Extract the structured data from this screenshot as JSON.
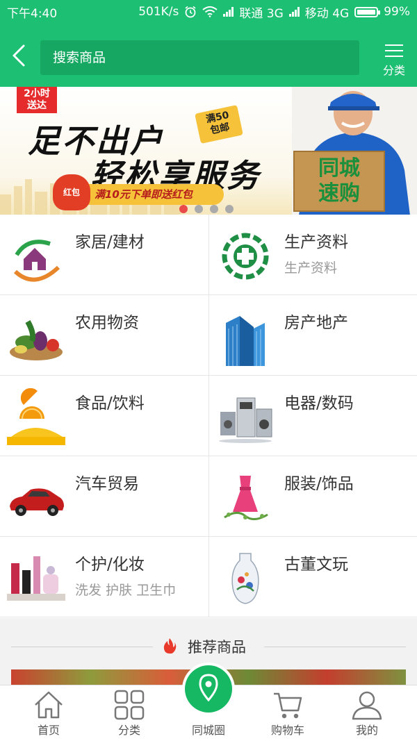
{
  "status_bar": {
    "time": "下午4:40",
    "speed": "501K/s",
    "carrier1": "联通 3G",
    "carrier2": "移动 4G",
    "battery": "99%"
  },
  "header": {
    "search_placeholder": "搜索商品",
    "category_label": "分类"
  },
  "banner": {
    "tag_line1": "2小时",
    "tag_line2": "送达",
    "slogan1": "足不出户",
    "slogan2": "轻松享服务",
    "stamp_line1": "满50",
    "stamp_line2": "包邮",
    "redbag_label": "红包",
    "promo_text": "满10元下单即送红包",
    "box_line1": "同城",
    "box_line2": "速购",
    "slide_count": 4,
    "active_slide": 1
  },
  "categories": [
    {
      "title": "家居/建材",
      "subtitle": "",
      "icon": "house-icon"
    },
    {
      "title": "生产资料",
      "subtitle": "生产资料",
      "icon": "production-emblem-icon"
    },
    {
      "title": "农用物资",
      "subtitle": "",
      "icon": "vegetables-icon"
    },
    {
      "title": "房产地产",
      "subtitle": "",
      "icon": "building-icon"
    },
    {
      "title": "食品/饮料",
      "subtitle": "",
      "icon": "orange-juice-icon"
    },
    {
      "title": "电器/数码",
      "subtitle": "",
      "icon": "appliances-icon"
    },
    {
      "title": "汽车贸易",
      "subtitle": "",
      "icon": "car-icon"
    },
    {
      "title": "服装/饰品",
      "subtitle": "",
      "icon": "dress-icon"
    },
    {
      "title": "个护/化妆",
      "subtitle": "洗发 护肤 卫生巾",
      "icon": "cosmetics-icon"
    },
    {
      "title": "古董文玩",
      "subtitle": "",
      "icon": "vase-icon"
    }
  ],
  "recommend": {
    "title": "推荐商品",
    "icon": "fire-icon"
  },
  "tabbar": {
    "home": "首页",
    "category": "分类",
    "city_circle": "同城圈",
    "cart": "购物车",
    "mine": "我的"
  },
  "colors": {
    "brand_green": "#1dbf73",
    "search_bg": "#16a862",
    "dot_active": "#e94a4a"
  }
}
